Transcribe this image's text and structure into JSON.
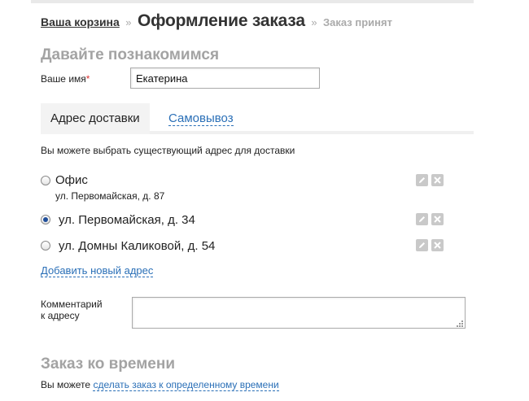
{
  "breadcrumb": {
    "cart": "Ваша корзина",
    "separator": "»",
    "current": "Оформление заказа",
    "next": "Заказ принят"
  },
  "intro": {
    "title": "Давайте познакомимся",
    "name_label": "Ваше имя",
    "required_mark": "*",
    "name_value": "Екатерина"
  },
  "tabs": [
    {
      "label": "Адрес доставки",
      "active": true
    },
    {
      "label": "Самовывоз",
      "active": false
    }
  ],
  "delivery": {
    "hint": "Вы можете выбрать существующий адрес для доставки",
    "addresses": [
      {
        "title": "Офис",
        "subtitle": "ул. Первомайская, д. 87",
        "selected": false
      },
      {
        "title": "ул. Первомайская, д. 34",
        "selected": true
      },
      {
        "title": "ул. Домны Каликовой, д. 54",
        "selected": false
      }
    ],
    "add_link": "Добавить новый адрес",
    "comment_label_line1": "Комментарий",
    "comment_label_line2": "к адресу",
    "comment_value": ""
  },
  "timed_order": {
    "title": "Заказ ко времени",
    "hint_prefix": "Вы можете",
    "link": "сделать заказ к определенному времени"
  },
  "colors": {
    "link": "#2a6fb7",
    "section_title": "#a3a3a3",
    "required": "#dd3333",
    "icon_button": "#c9c9c9"
  },
  "icons": {
    "edit": "pencil-icon",
    "delete": "close-icon"
  }
}
